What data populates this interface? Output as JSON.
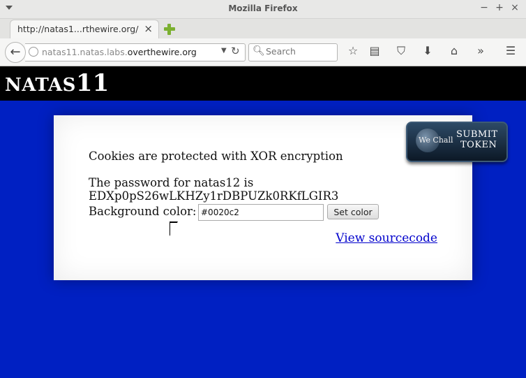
{
  "window": {
    "title": "Mozilla Firefox",
    "controls": [
      "−",
      "+",
      "×"
    ]
  },
  "tabs": [
    {
      "label": "http://natas1...rthewire.org/",
      "close": "×"
    }
  ],
  "navbar": {
    "url_prefix": "natas11.natas.labs.",
    "url_domain": "overthewire.org",
    "search_placeholder": "Search"
  },
  "icons": [
    "back-arrow-icon",
    "globe-icon",
    "dropdown-icon",
    "reload-icon",
    "search-icon",
    "star-icon",
    "reading-list-icon",
    "pocket-icon",
    "download-icon",
    "home-icon",
    "overflow-icon",
    "hamburger-menu-icon"
  ],
  "page": {
    "logo_small": "NATAS",
    "logo_big": "11",
    "heading": "Cookies are protected with XOR encryption",
    "password_line": "The password for natas12 is",
    "password": "EDXp0pS26wLKHZy1rDBPUZk0RKfLGIR3",
    "bg_label": "Background color:",
    "bg_value": "#0020c2",
    "set_button": "Set color",
    "view_source": "View sourcecode",
    "badge": {
      "brand": "We Chall",
      "line1": "SUBMIT",
      "line2": "TOKEN"
    }
  },
  "colors": {
    "page_background": "#0020c2",
    "header": "#000000",
    "link": "#0000cc"
  }
}
